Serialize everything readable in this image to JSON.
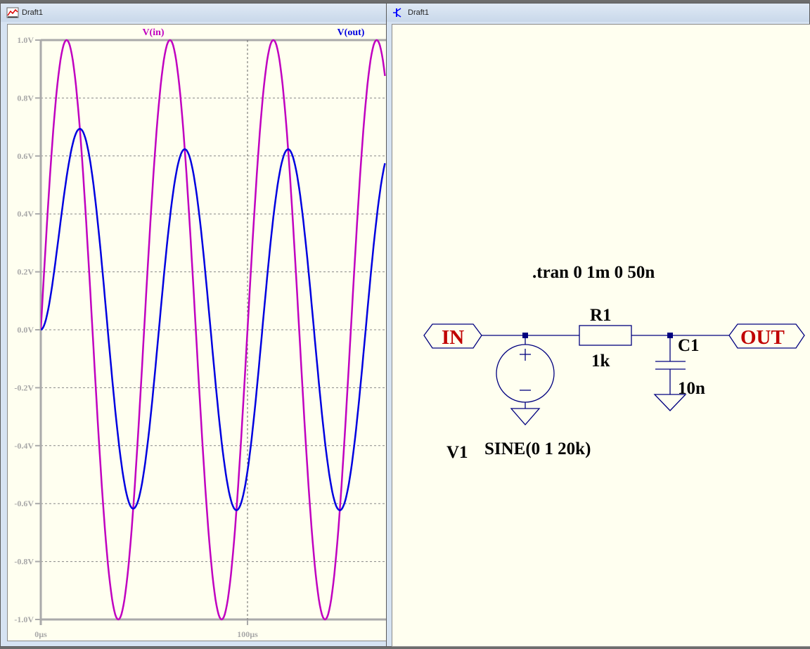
{
  "waveform_window": {
    "title": "Draft1",
    "icon": "waveform-icon"
  },
  "schematic_window": {
    "title": "Draft1",
    "icon": "transistor-schematic-icon"
  },
  "chart_data": {
    "type": "line",
    "title": "",
    "xlabel": "",
    "ylabel": "",
    "xlim_us": [
      0,
      167
    ],
    "ylim": [
      -1.0,
      1.0
    ],
    "x_ticks": [
      "0µs",
      "100µs"
    ],
    "x_tick_values": [
      0,
      100
    ],
    "y_ticks": [
      "1.0V",
      "0.8V",
      "0.6V",
      "0.4V",
      "0.2V",
      "0.0V",
      "-0.2V",
      "-0.4V",
      "-0.6V",
      "-0.8V",
      "-1.0V"
    ],
    "y_tick_values": [
      1.0,
      0.8,
      0.6,
      0.4,
      0.2,
      0.0,
      -0.2,
      -0.4,
      -0.6,
      -0.8,
      -1.0
    ],
    "grid": true,
    "legend_placement": "top",
    "series": [
      {
        "name": "V(in)",
        "color": "#c000c0",
        "kind": "sine",
        "amplitude": 1,
        "frequency_hz": 20000
      },
      {
        "name": "V(out)",
        "color": "#0000e0",
        "kind": "rc_lowpass_of_vin",
        "R_ohm": 1000,
        "C_farad": 1e-08,
        "first_peak": 0.69,
        "steady_peak": 0.62,
        "steady_trough": -0.62
      }
    ]
  },
  "schematic": {
    "directive": ".tran 0 1m 0 50n",
    "in_label": "IN",
    "out_label": "OUT",
    "r_name": "R1",
    "r_value": "1k",
    "c_name": "C1",
    "c_value": "10n",
    "v_name": "V1",
    "v_value": "SINE(0 1 20k)",
    "wire_color": "#00007f",
    "label_color": "#c00000"
  }
}
